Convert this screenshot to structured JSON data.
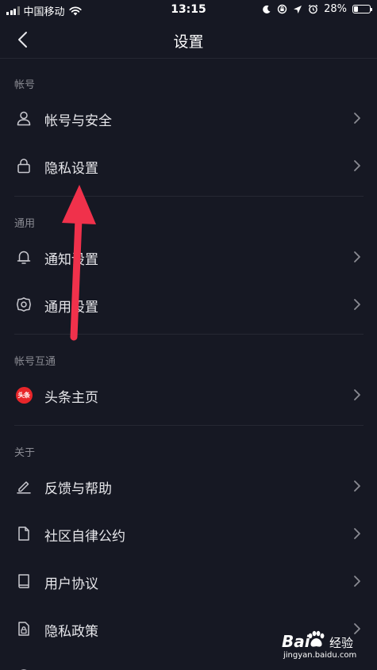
{
  "status_bar": {
    "carrier": "中国移动",
    "time": "13:15",
    "battery": "28%",
    "battery_level": 0.28
  },
  "nav": {
    "title": "设置"
  },
  "sections": [
    {
      "header": "帐号",
      "items": [
        {
          "label": "帐号与安全",
          "icon": "user-icon"
        },
        {
          "label": "隐私设置",
          "icon": "lock-icon"
        }
      ]
    },
    {
      "header": "通用",
      "items": [
        {
          "label": "通知设置",
          "icon": "bell-icon"
        },
        {
          "label": "通用设置",
          "icon": "gear-icon"
        }
      ]
    },
    {
      "header": "帐号互通",
      "items": [
        {
          "label": "头条主页",
          "icon": "toutiao-logo-icon",
          "badge": "头条"
        }
      ]
    },
    {
      "header": "关于",
      "items": [
        {
          "label": "反馈与帮助",
          "icon": "pencil-icon"
        },
        {
          "label": "社区自律公约",
          "icon": "document-icon"
        },
        {
          "label": "用户协议",
          "icon": "book-icon"
        },
        {
          "label": "隐私政策",
          "icon": "lock-document-icon"
        }
      ]
    }
  ],
  "colors": {
    "background": "#161823",
    "annotation_arrow": "#f0314b",
    "toutiao_red": "#e8262a"
  },
  "watermark": {
    "brand": "Bai",
    "brand_suffix": "经验",
    "url": "jingyan.baidu.com"
  }
}
